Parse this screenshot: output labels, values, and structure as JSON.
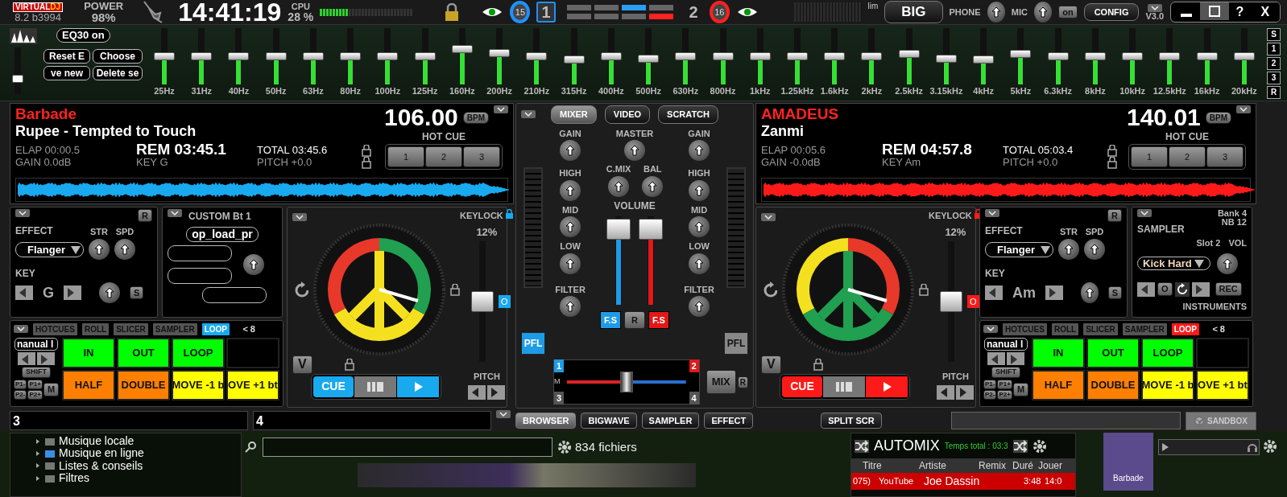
{
  "top_bar": {
    "logo_left": "VIRTUAL",
    "logo_right": "DJ",
    "version": "8.2 b3994",
    "power_label": "POWER",
    "power_value": "98%",
    "clock": "14:41:19",
    "cpu_label": "CPU",
    "cpu_value": "28 %",
    "cpu_meter": {
      "level": 0.3
    },
    "deck_selector": [
      {
        "counter": "15",
        "label": "1",
        "selected": true,
        "color": "#1e90ff"
      },
      {
        "counter": "16",
        "label": "2",
        "selected": false,
        "color": "#ff2020"
      }
    ],
    "lim_label": "lim",
    "big_button": "BIG",
    "phone_label": "PHONE",
    "mic_label": "MIC",
    "mic_on": "on",
    "config_button": "CONFIG",
    "skin_version": "V3.0",
    "help_button": "?",
    "close_button": "X"
  },
  "eq": {
    "toggle": "EQ30 on",
    "buttons": [
      "Reset E",
      "Choose",
      "ve new",
      "Delete se"
    ],
    "preamp": {
      "level": 0.3
    },
    "bands": [
      {
        "label": "25Hz",
        "level": 0.5
      },
      {
        "label": "31Hz",
        "level": 0.5
      },
      {
        "label": "40Hz",
        "level": 0.5
      },
      {
        "label": "50Hz",
        "level": 0.5
      },
      {
        "label": "63Hz",
        "level": 0.5
      },
      {
        "label": "80Hz",
        "level": 0.5
      },
      {
        "label": "100Hz",
        "level": 0.5
      },
      {
        "label": "125Hz",
        "level": 0.5
      },
      {
        "label": "160Hz",
        "level": 0.63
      },
      {
        "label": "200Hz",
        "level": 0.56
      },
      {
        "label": "210Hz",
        "level": 0.5
      },
      {
        "label": "315Hz",
        "level": 0.45
      },
      {
        "label": "400Hz",
        "level": 0.5
      },
      {
        "label": "500Hz",
        "level": 0.46
      },
      {
        "label": "630Hz",
        "level": 0.5
      },
      {
        "label": "800Hz",
        "level": 0.5
      },
      {
        "label": "1kHz",
        "level": 0.5
      },
      {
        "label": "1.25kHz",
        "level": 0.5
      },
      {
        "label": "1.6kHz",
        "level": 0.5
      },
      {
        "label": "2kHz",
        "level": 0.5
      },
      {
        "label": "2.5kHz",
        "level": 0.54
      },
      {
        "label": "3.15kHz",
        "level": 0.46
      },
      {
        "label": "4kHz",
        "level": 0.45
      },
      {
        "label": "5kHz",
        "level": 0.55
      },
      {
        "label": "6.3kHz",
        "level": 0.5
      },
      {
        "label": "8kHz",
        "level": 0.5
      },
      {
        "label": "10kHz",
        "level": 0.5
      },
      {
        "label": "12.5kHz",
        "level": 0.5
      },
      {
        "label": "16kHz",
        "level": 0.5
      },
      {
        "label": "20kHz",
        "level": 0.5
      }
    ],
    "side_buttons": [
      "S",
      "1",
      "2",
      "3",
      "R"
    ]
  },
  "decks": [
    {
      "artist": "Barbade",
      "title": "Rupee - Tempted to Touch",
      "bpm": "106.00",
      "bpm_label": "BPM",
      "hot_cue_label": "HOT CUE",
      "hot_cues": [
        "1",
        "2",
        "3"
      ],
      "elap": "ELAP 00:00.5",
      "gain": "GAIN 0.0dB",
      "rem": "REM 03:45.1",
      "key": "KEY G",
      "total": "TOTAL 03:45.6",
      "pitch": "PITCH +0.0",
      "color": "#19a9ef",
      "effect": {
        "label": "EFFECT",
        "name": "Flanger",
        "str": "STR",
        "spd": "SPD",
        "reset": "R",
        "key_label": "KEY",
        "key_value": "G",
        "sync": "S"
      },
      "side_panel": {
        "kind": "custom",
        "title": "CUSTOM Bt 1",
        "button": "op_load_pr"
      },
      "keylock": "KEYLOCK",
      "keylock_value": "12%",
      "pitch_slider": {
        "level": 0.5
      },
      "pitch_zero": "O",
      "pitch_label": "PITCH",
      "v_button": "V",
      "cue": "CUE",
      "pad_tabs": [
        {
          "label": "HOTCUES",
          "selected": false
        },
        {
          "label": "ROLL",
          "selected": false
        },
        {
          "label": "SLICER",
          "selected": false
        },
        {
          "label": "SAMPLER",
          "selected": false
        },
        {
          "label": "LOOP",
          "selected": true
        }
      ],
      "loop_size": "< 8",
      "pad_mode": "nanual l",
      "shift": "SHIFT",
      "page_buttons": [
        "P1-",
        "P1+",
        "P2-",
        "P2+"
      ],
      "m_button": "M",
      "pads": [
        {
          "label": "IN",
          "color": "#00ff00"
        },
        {
          "label": "OUT",
          "color": "#00ff00"
        },
        {
          "label": "LOOP",
          "color": "#00ff00"
        },
        {
          "color": "#000000"
        },
        {
          "label": "HALF",
          "color": "#ff7f00"
        },
        {
          "label": "DOUBLE",
          "color": "#ff7f00"
        },
        {
          "label": "MOVE -1 b",
          "color": "#ffff00"
        },
        {
          "label": "OVE +1 bt",
          "color": "#ffff00"
        }
      ]
    },
    {
      "artist": "AMADEUS",
      "title": "Zanmi",
      "bpm": "140.01",
      "bpm_label": "BPM",
      "hot_cue_label": "HOT CUE",
      "hot_cues": [
        "1",
        "2",
        "3"
      ],
      "elap": "ELAP 00:05.6",
      "gain": "GAIN -0.0dB",
      "rem": "REM 04:57.8",
      "key": "KEY Am",
      "total": "TOTAL 05:03.4",
      "pitch": "PITCH +0.0",
      "color": "#ff1a1a",
      "effect": {
        "label": "EFFECT",
        "name": "Flanger",
        "str": "STR",
        "spd": "SPD",
        "reset": "R",
        "key_label": "KEY",
        "key_value": "Am",
        "sync": "S"
      },
      "side_panel": {
        "kind": "sampler",
        "title": "SAMPLER",
        "bank": "Bank 4",
        "nb": "NB 12",
        "slot": "Slot 2",
        "vol": "VOL",
        "sample": "Kick Hard",
        "zero": "O",
        "rec": "REC",
        "instruments": "INSTRUMENTS"
      },
      "keylock": "KEYLOCK",
      "keylock_value": "12%",
      "pitch_slider": {
        "level": 0.5
      },
      "pitch_zero": "O",
      "pitch_label": "PITCH",
      "v_button": "V",
      "cue": "CUE",
      "pad_tabs": [
        {
          "label": "HOTCUES",
          "selected": false
        },
        {
          "label": "ROLL",
          "selected": false
        },
        {
          "label": "SLICER",
          "selected": false
        },
        {
          "label": "SAMPLER",
          "selected": false
        },
        {
          "label": "LOOP",
          "selected": true
        }
      ],
      "loop_size": "< 8",
      "pad_mode": "nanual l",
      "shift": "SHIFT",
      "page_buttons": [
        "P1-",
        "P1+",
        "P2-",
        "P2+"
      ],
      "m_button": "M",
      "pads": [
        {
          "label": "IN",
          "color": "#00ff00"
        },
        {
          "label": "OUT",
          "color": "#00ff00"
        },
        {
          "label": "LOOP",
          "color": "#00ff00"
        },
        {
          "color": "#000000"
        },
        {
          "label": "HALF",
          "color": "#ff7f00"
        },
        {
          "label": "DOUBLE",
          "color": "#ff7f00"
        },
        {
          "label": "MOVE -1 b",
          "color": "#ffff00"
        },
        {
          "label": "OVE +1 bt",
          "color": "#ffff00"
        }
      ]
    }
  ],
  "mixer": {
    "tabs": [
      {
        "label": "MIXER",
        "selected": true
      },
      {
        "label": "VIDEO",
        "selected": false
      },
      {
        "label": "SCRATCH",
        "selected": false
      }
    ],
    "master_label": "MASTER",
    "cmix_label": "C.MIX",
    "bal_label": "BAL",
    "volume_label": "VOLUME",
    "reset": "R",
    "channels": [
      {
        "gain": "GAIN",
        "high": "HIGH",
        "mid": "MID",
        "low": "LOW",
        "filter": "FILTER",
        "pfl": "PFL",
        "pfl_on": true,
        "fs": "F.S",
        "volume": {
          "level": 0.85
        },
        "color": "#1e9be6"
      },
      {
        "gain": "GAIN",
        "high": "HIGH",
        "mid": "MID",
        "low": "LOW",
        "filter": "FILTER",
        "pfl": "PFL",
        "pfl_on": false,
        "fs": "F.S",
        "volume": {
          "level": 0.85
        },
        "color": "#e01818"
      }
    ],
    "crossfader": {
      "level": 0.5
    },
    "corner_labels": [
      "1",
      "2",
      "3",
      "4"
    ],
    "m_label": "M",
    "mix": "MIX",
    "mix_r": "R"
  },
  "bottom_bar": {
    "deck3": "3",
    "deck4": "4",
    "views": [
      {
        "label": "BROWSER",
        "selected": true
      },
      {
        "label": "BIGWAVE",
        "selected": false
      },
      {
        "label": "SAMPLER",
        "selected": false
      },
      {
        "label": "EFFECT",
        "selected": false
      }
    ],
    "split": "SPLIT SCR",
    "sandbox": "SANDBOX"
  },
  "browser": {
    "folders": [
      "Musique locale",
      "Musique en ligne",
      "Listes & conseils",
      "Filtres"
    ],
    "file_count": "834 fichiers",
    "automix": {
      "title": "AUTOMIX",
      "total": "Temps total : 03:3",
      "columns": [
        "Titre",
        "Artiste",
        "Remix",
        "Duré",
        "Jouer"
      ],
      "rows": [
        {
          "index": "075)",
          "title": "YouTube",
          "artist": "Joe Dassin",
          "duration": "3:48",
          "played": "14:0"
        }
      ]
    },
    "now_playing": "Barbade"
  }
}
